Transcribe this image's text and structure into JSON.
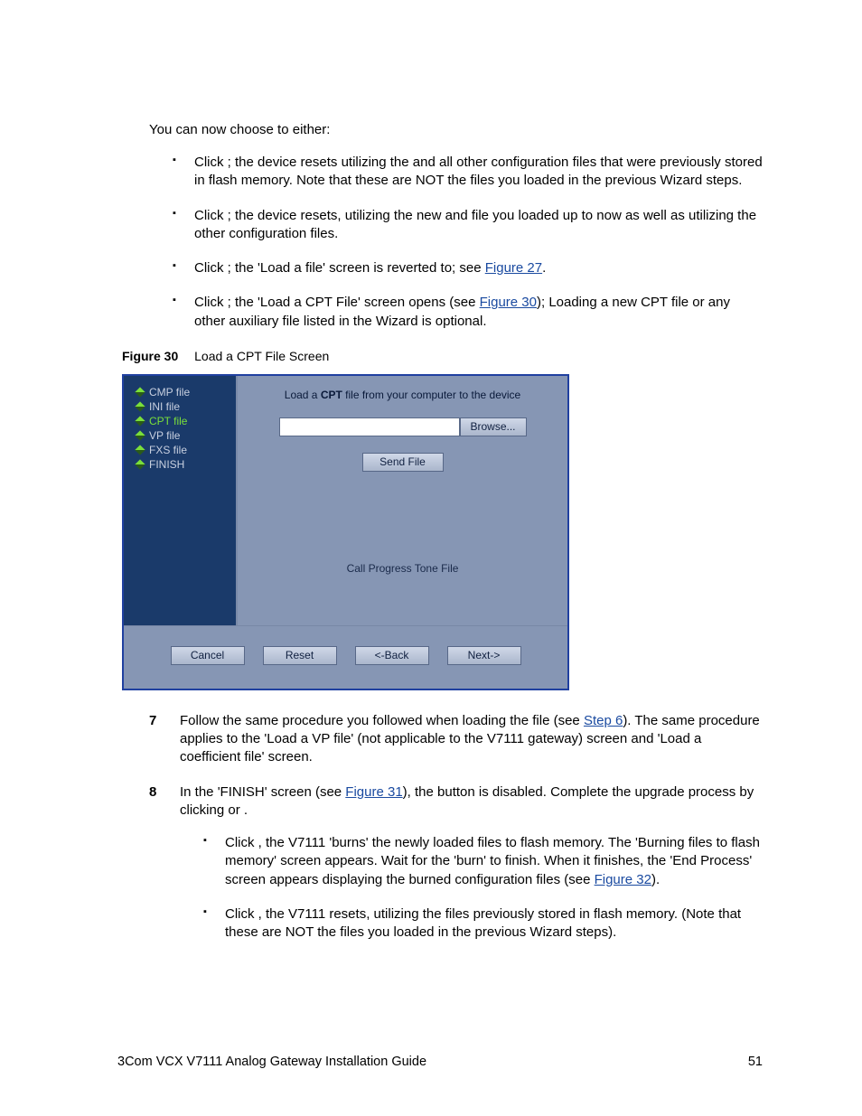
{
  "intro": "You can now choose to either:",
  "bullets_top": [
    {
      "prefix": "Click ",
      "mid": "; the device resets utilizing the ",
      "tail": " and all other configuration files that were previously stored in flash memory. Note that these are NOT the files you loaded in the previous Wizard steps."
    },
    {
      "prefix": "Click ",
      "mid": "; the device resets, utilizing the new ",
      "mid2": " and ",
      "tail": " file you loaded up to now as well as utilizing the other configuration files."
    },
    {
      "prefix": "Click ",
      "mid": "; the 'Load a ",
      "mid2": " file' screen is reverted to; see ",
      "link": "Figure 27",
      "tail": "."
    },
    {
      "prefix": "Click ",
      "mid": "; the 'Load a CPT File' screen opens (see ",
      "link": "Figure 30",
      "tail": "); Loading a new CPT file or any other auxiliary file listed in the Wizard is optional."
    }
  ],
  "figure": {
    "label": "Figure 30",
    "title": "Load a CPT File Screen"
  },
  "wizard": {
    "side_items": [
      {
        "label": "CMP file",
        "active": false
      },
      {
        "label": "INI file",
        "active": false
      },
      {
        "label": "CPT file",
        "active": true
      },
      {
        "label": "VP file",
        "active": false
      },
      {
        "label": "FXS file",
        "active": false
      },
      {
        "label": "FINISH",
        "active": false
      }
    ],
    "heading_pre": "Load a ",
    "heading_bold": "CPT",
    "heading_post": " file from your computer to the device",
    "browse": "Browse...",
    "send": "Send File",
    "subheading": "Call Progress Tone File",
    "nav": {
      "cancel": "Cancel",
      "reset": "Reset",
      "back": "<-Back",
      "next": "Next->"
    }
  },
  "steps": [
    {
      "num": "7",
      "pre": "Follow the same procedure you followed when loading the ",
      "mid": " file (see ",
      "link": "Step 6",
      "post": "). The same procedure applies to the 'Load a VP file' (not applicable to the V7111 gateway) screen and 'Load a coefficient file' screen."
    },
    {
      "num": "8",
      "pre": "In the 'FINISH' screen (see ",
      "link": "Figure 31",
      "mid": "), the ",
      "mid2": " button is disabled. Complete the upgrade process by clicking ",
      "mid3": " or ",
      "post": ".",
      "sub_bullets": [
        {
          "prefix": "Click ",
          "mid": ", the V7111 'burns' the newly loaded files to flash memory. The 'Burning files to flash memory' screen appears. Wait for the 'burn' to finish. When it finishes, the 'End Process' screen appears displaying the burned configuration files (see ",
          "link": "Figure 32",
          "tail": ")."
        },
        {
          "prefix": "Click ",
          "mid": ", the V7111 resets, utilizing the files previously stored in flash memory. (Note that these are NOT the files you loaded in the previous Wizard steps).",
          "link": "",
          "tail": ""
        }
      ]
    }
  ],
  "footer": {
    "left": "3Com VCX V7111 Analog Gateway Installation Guide",
    "right": "51"
  }
}
